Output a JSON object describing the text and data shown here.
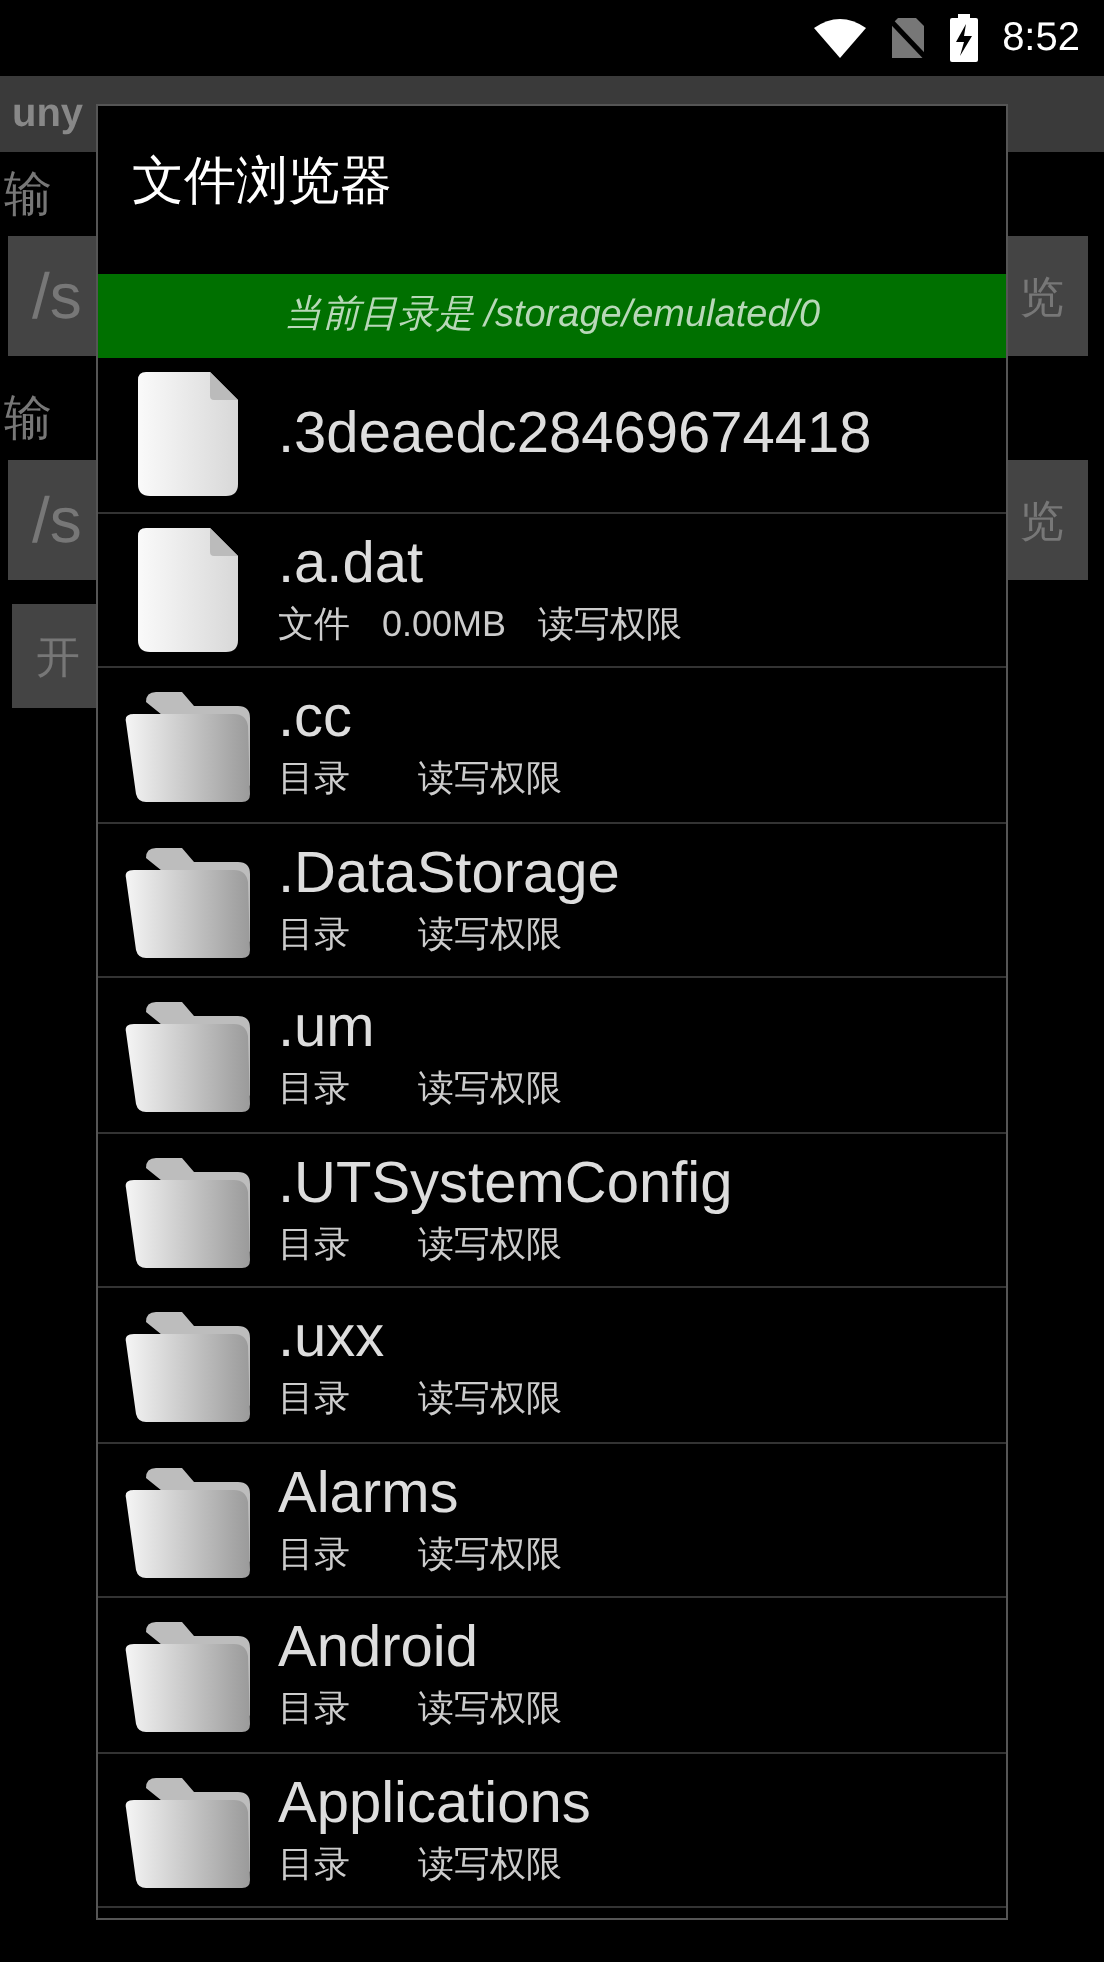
{
  "status_bar": {
    "time": "8:52"
  },
  "app": {
    "title": "uny",
    "sections": [
      {
        "label": "输",
        "value": "/s",
        "button": "览"
      },
      {
        "label": "输",
        "value": "/s",
        "button": "览"
      }
    ],
    "start_button": "开"
  },
  "dialog": {
    "title": "文件浏览器",
    "current_dir": "当前目录是 /storage/emulated/0",
    "items": [
      {
        "kind": "file",
        "name": ".3deaedc28469674418"
      },
      {
        "kind": "file",
        "name": ".a.dat",
        "type": "文件",
        "size": "0.00MB",
        "permission": "读写权限"
      },
      {
        "kind": "folder",
        "name": ".cc",
        "type": "目录",
        "permission": "读写权限"
      },
      {
        "kind": "folder",
        "name": ".DataStorage",
        "type": "目录",
        "permission": "读写权限"
      },
      {
        "kind": "folder",
        "name": ".um",
        "type": "目录",
        "permission": "读写权限"
      },
      {
        "kind": "folder",
        "name": ".UTSystemConfig",
        "type": "目录",
        "permission": "读写权限"
      },
      {
        "kind": "folder",
        "name": ".uxx",
        "type": "目录",
        "permission": "读写权限"
      },
      {
        "kind": "folder",
        "name": "Alarms",
        "type": "目录",
        "permission": "读写权限"
      },
      {
        "kind": "folder",
        "name": "Android",
        "type": "目录",
        "permission": "读写权限"
      },
      {
        "kind": "folder",
        "name": "Applications",
        "type": "目录",
        "permission": "读写权限"
      }
    ]
  }
}
